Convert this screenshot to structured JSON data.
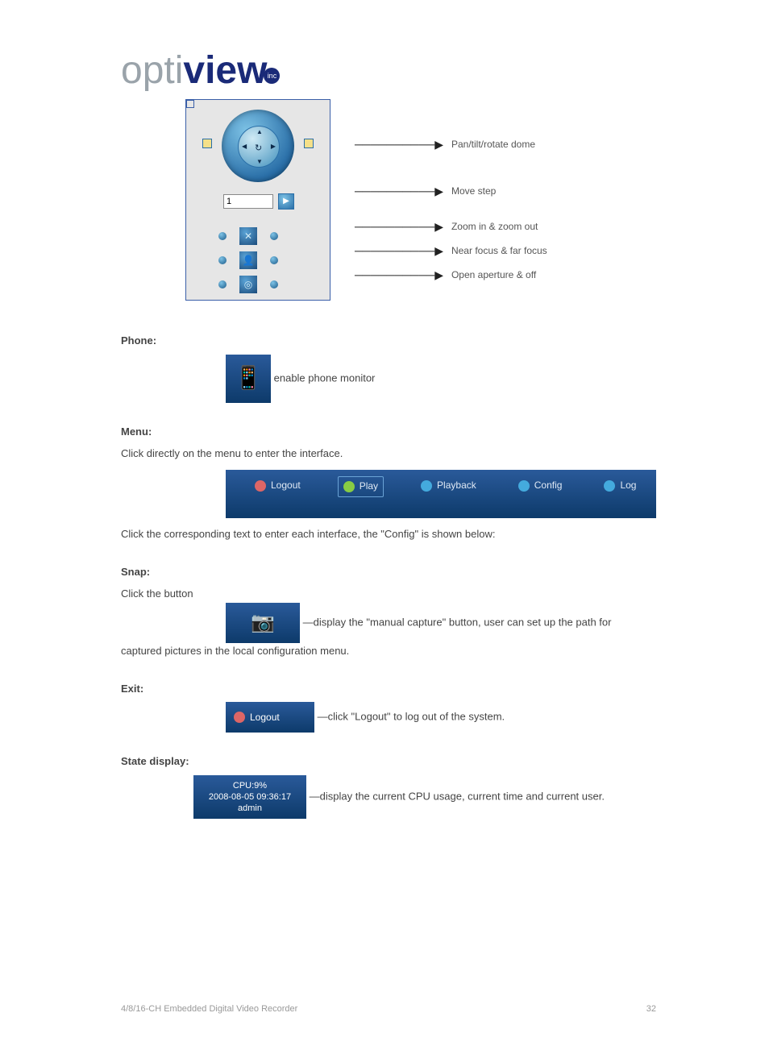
{
  "logo": {
    "thin": "opti",
    "bold": "view",
    "sub": "inc"
  },
  "ptz": {
    "step_value": "1",
    "labels": {
      "dial": "Pan/tilt/rotate dome",
      "step": "Move step",
      "zoom": "Zoom in & zoom out",
      "focus": "Near focus & far focus",
      "aperture": "Open aperture & off"
    }
  },
  "phone": {
    "heading": "Phone:",
    "icon_label": "enable phone monitor"
  },
  "menu": {
    "heading": "Menu:",
    "intro_a": "Click ",
    "intro_b": " directly on the menu to enter the interface.",
    "tabs": {
      "logout": "Logout",
      "play": "Play",
      "playback": "Playback",
      "config": "Config",
      "log": "Log"
    },
    "detail": "Click the corresponding text to enter each interface, the \"Config\" is shown below:"
  },
  "snap": {
    "heading": "Snap:",
    "leadin": "Click the button",
    "desc1": "—display the \"manual capture\" button, user can set up the path for",
    "desc2": "captured pictures in the local configuration menu."
  },
  "logout": {
    "heading": "Exit:",
    "label": "Logout",
    "desc": "—click \"Logout\" to log out of the system."
  },
  "status": {
    "heading": "State display:",
    "cpu": "CPU:9%",
    "time": "2008-08-05 09:36:17",
    "user": "admin",
    "desc": "—display the current CPU usage, current time and current user."
  },
  "footer": {
    "left": "4/8/16-CH Embedded Digital Video Recorder",
    "right": "32"
  }
}
